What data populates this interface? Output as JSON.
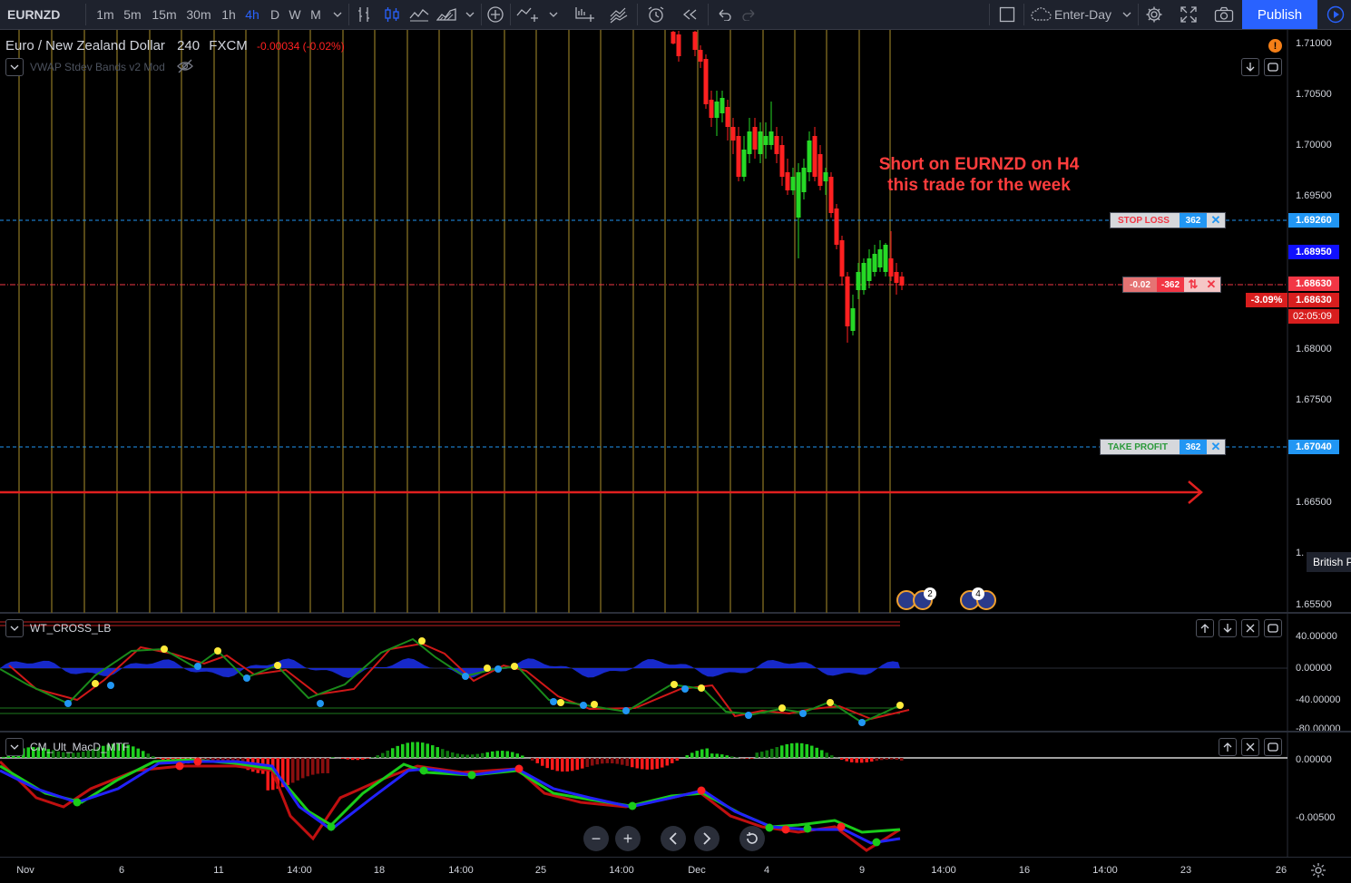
{
  "toolbar": {
    "symbol": "EURNZD",
    "intervals": [
      "1m",
      "5m",
      "15m",
      "30m",
      "1h",
      "4h",
      "D",
      "W",
      "M"
    ],
    "active_interval": "4h",
    "layout_name": "Enter-Day",
    "publish_label": "Publish"
  },
  "main_pane": {
    "title": "Euro / New Zealand Dollar",
    "interval": "240",
    "source": "FXCM",
    "change": "-0.00034 (-0.02%)",
    "indicator_name": "VWAP Stdev Bands v2 Mod",
    "annotation_line1": "Short on EURNZD on H4",
    "annotation_line2": "this trade for the week",
    "price_ticks": [
      "1.71000",
      "1.70500",
      "1.70000",
      "1.69500",
      "1.68000",
      "1.67500",
      "1.66500",
      "1.65500"
    ],
    "partial_tick": "1.",
    "tooltip": "British P",
    "event_badges": [
      "2",
      "4"
    ]
  },
  "orders": {
    "stop_loss": {
      "label": "STOP LOSS",
      "qty": "362",
      "price": "1.69260"
    },
    "position": {
      "pnl": "-0.02",
      "qty": "-362",
      "price": "1.68630"
    },
    "take_profit": {
      "label": "TAKE PROFIT",
      "qty": "362",
      "price": "1.67040"
    },
    "close_glyph": "✕",
    "reverse_glyph": "⇅"
  },
  "price_tags": {
    "bid": "1.68950",
    "last": "1.68630",
    "change_pct": "-3.09%",
    "countdown": "02:05:09"
  },
  "wt_pane": {
    "title": "WT_CROSS_LB",
    "ticks": [
      "40.00000",
      "0.00000",
      "-40.00000",
      "-80.00000"
    ]
  },
  "macd_pane": {
    "title": "CM_Ult_MacD_MTF",
    "ticks": [
      "0.00000",
      "-0.00500"
    ]
  },
  "time_axis": {
    "labels": [
      "Nov",
      "6",
      "11",
      "14:00",
      "18",
      "14:00",
      "25",
      "14:00",
      "Dec",
      "4",
      "9",
      "14:00",
      "16",
      "14:00",
      "23",
      "26"
    ]
  },
  "colors": {
    "bull": "#26d926",
    "bear": "#ff2020",
    "accent": "#2962ff",
    "stop_line": "#2196f3",
    "arrow": "#e0201f",
    "vlines": "#6b5a1c"
  },
  "icons": {
    "alert": "alert-icon",
    "settings": "gear-icon",
    "fullscreen": "fullscreen-icon",
    "snapshot": "camera-icon"
  }
}
